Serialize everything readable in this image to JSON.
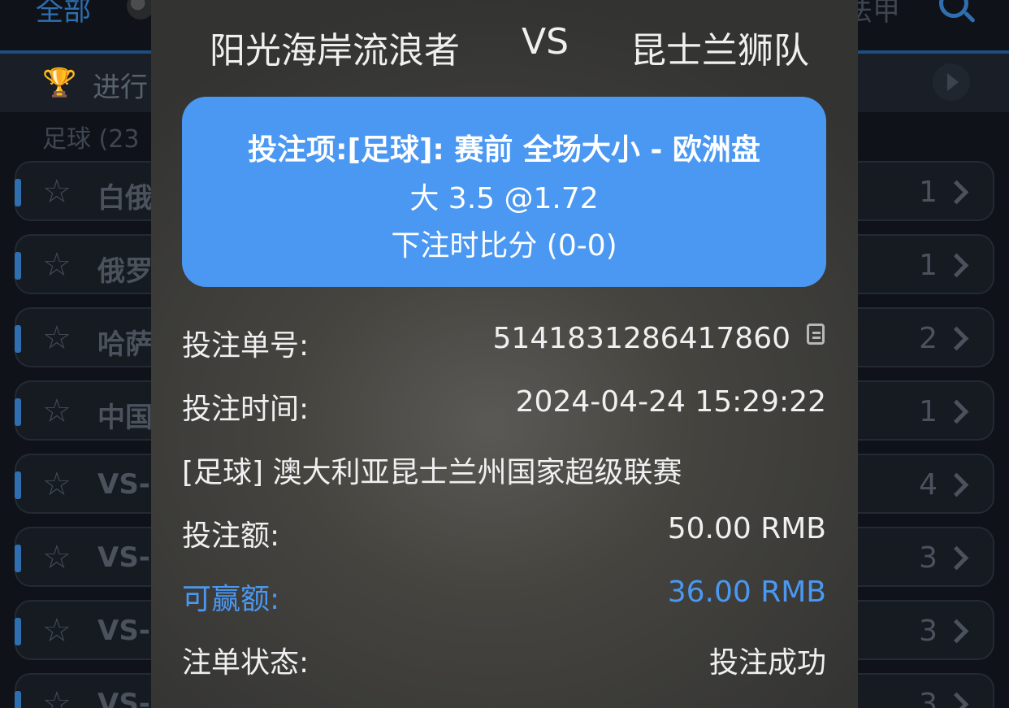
{
  "background": {
    "top_tabs": {
      "all": "全部",
      "right": "法甲"
    },
    "subbar": {
      "live_label": "进行"
    },
    "section_label": "足球 (23",
    "rows": [
      {
        "label": "白俄",
        "count": "1"
      },
      {
        "label": "俄罗",
        "count": "1"
      },
      {
        "label": "哈萨",
        "count": "2"
      },
      {
        "label": "中国",
        "count": "1"
      },
      {
        "label": "VS-",
        "count": "4"
      },
      {
        "label": "VS-",
        "count": "3"
      },
      {
        "label": "VS-",
        "count": "3"
      },
      {
        "label": "VS-",
        "count": "3"
      }
    ]
  },
  "modal": {
    "team_home": "阳光海岸流浪者",
    "vs": "VS",
    "team_away": "昆士兰狮队",
    "bet_card": {
      "item": "投注项:[足球]: 赛前 全场大小 - 欧洲盘",
      "odds": "大 3.5 @1.72",
      "score": "下注时比分 (0-0)"
    },
    "bet_no_label": "投注单号:",
    "bet_no": "5141831286417860",
    "bet_time_label": "投注时间:",
    "bet_time": "2024-04-24 15:29:22",
    "league": "[足球] 澳大利亚昆士兰州国家超级联赛",
    "amount_label": "投注额:",
    "amount": "50.00 RMB",
    "win_label": "可赢额:",
    "win": "36.00 RMB",
    "status_label": "注单状态:",
    "status": "投注成功"
  },
  "colors": {
    "accent": "#4b98f2",
    "overlay": "#3f3e3b"
  },
  "icons": [
    "ball-icon",
    "search-icon",
    "trophy-icon",
    "play-icon",
    "star-icon",
    "chevron-right-icon",
    "copy-icon"
  ]
}
